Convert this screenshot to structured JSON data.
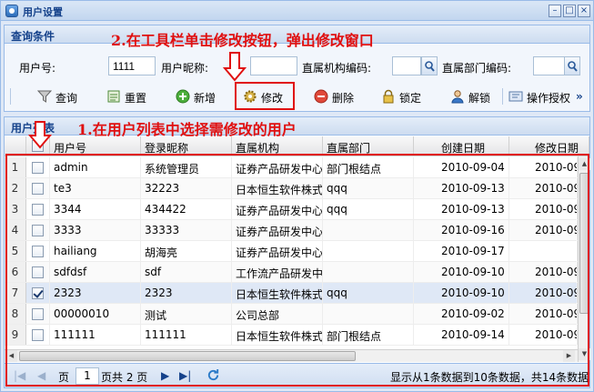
{
  "window": {
    "title": "用户设置",
    "controls": [
      "minimize",
      "maximize",
      "close"
    ]
  },
  "query_panel": {
    "title": "查询条件",
    "fields": {
      "user_no": {
        "label": "用户号:",
        "value": "1111"
      },
      "nickname": {
        "label": "用户昵称:",
        "value": ""
      },
      "org_code": {
        "label": "直属机构编码:",
        "value": ""
      },
      "dept_code": {
        "label": "直属部门编码:",
        "value": ""
      }
    }
  },
  "toolbar": {
    "query": "查询",
    "reset": "重置",
    "add": "新增",
    "edit": "修改",
    "delete": "删除",
    "lock": "锁定",
    "unlock": "解锁",
    "authorize": "操作授权",
    "more": "»"
  },
  "grid": {
    "title": "用户列表",
    "columns": [
      "用户号",
      "登录昵称",
      "直属机构",
      "直属部门",
      "创建日期",
      "修改日期"
    ],
    "rows": [
      {
        "num": "1",
        "checked": false,
        "user_no": "admin",
        "nickname": "系统管理员",
        "org": "证券产品研发中心",
        "dept": "部门根结点",
        "created": "2010-09-04",
        "modified": "2010-09-"
      },
      {
        "num": "2",
        "checked": false,
        "user_no": "te3",
        "nickname": "32223",
        "org": "日本恒生软件株式",
        "dept": "qqq",
        "created": "2010-09-13",
        "modified": "2010-09-"
      },
      {
        "num": "3",
        "checked": false,
        "user_no": "3344",
        "nickname": "434422",
        "org": "证券产品研发中心",
        "dept": "qqq",
        "created": "2010-09-13",
        "modified": "2010-09-"
      },
      {
        "num": "4",
        "checked": false,
        "user_no": "3333",
        "nickname": "33333",
        "org": "证券产品研发中心",
        "dept": "",
        "created": "2010-09-16",
        "modified": "2010-09-"
      },
      {
        "num": "5",
        "checked": false,
        "user_no": "hailiang",
        "nickname": "胡海亮",
        "org": "证券产品研发中心",
        "dept": "",
        "created": "2010-09-17",
        "modified": ""
      },
      {
        "num": "6",
        "checked": false,
        "user_no": "sdfdsf",
        "nickname": "sdf",
        "org": "工作流产品研发中",
        "dept": "",
        "created": "2010-09-10",
        "modified": "2010-09-"
      },
      {
        "num": "7",
        "checked": true,
        "user_no": "2323",
        "nickname": "2323",
        "org": "日本恒生软件株式",
        "dept": "qqq",
        "created": "2010-09-10",
        "modified": "2010-09-"
      },
      {
        "num": "8",
        "checked": false,
        "user_no": "00000010",
        "nickname": "测试",
        "org": "公司总部",
        "dept": "",
        "created": "2010-09-02",
        "modified": "2010-09-"
      },
      {
        "num": "9",
        "checked": false,
        "user_no": "111111",
        "nickname": "111111",
        "org": "日本恒生软件株式",
        "dept": "部门根结点",
        "created": "2010-09-14",
        "modified": "2010-09-"
      }
    ],
    "selected_row": 7
  },
  "pager": {
    "page_label": "页",
    "current_page": "1",
    "total_label": "页共 2 页",
    "status": "显示从1条数据到10条数据，共14条数据"
  },
  "annotations": {
    "step1": "1.在用户列表中选择需修改的用户",
    "step2": "2.在工具栏单击修改按钮，弹出修改窗口",
    "color": "#e01010"
  }
}
